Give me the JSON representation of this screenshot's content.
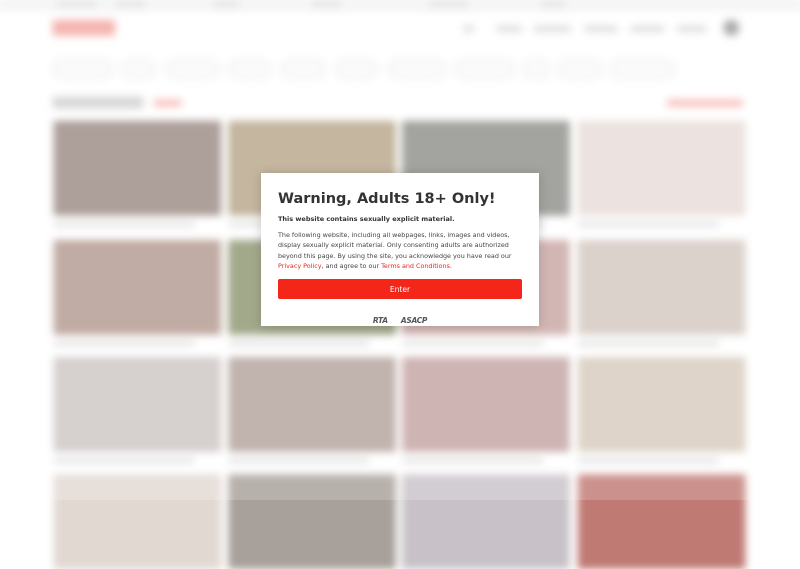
{
  "modal": {
    "title": "Warning, Adults 18+ Only!",
    "subtitle": "This website contains sexually explicit material.",
    "body_part1": "The following website, including all webpages, links, images and videos, display sexually explicit material. Only consenting adults are authorized beyond this page. By using the site, you acknowledge you have read our ",
    "privacy_link": "Privacy Policy",
    "body_part2": ", and agree to our ",
    "terms_link": "Terms and Conditions",
    "body_part3": ".",
    "enter_label": "Enter",
    "logo_rta": "RTA",
    "logo_asacp": "ASACP"
  },
  "colors": {
    "accent": "#f4261a",
    "link": "#e5281e"
  }
}
